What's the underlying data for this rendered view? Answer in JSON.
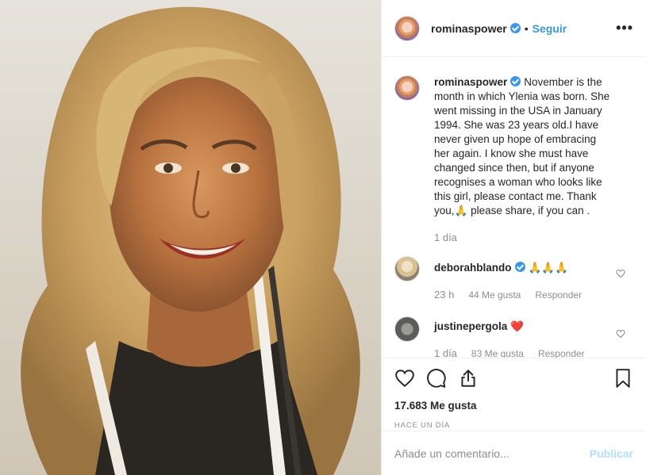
{
  "post": {
    "author": "rominaspower",
    "follow_label": "Seguir",
    "dot": "•",
    "more_label": "•••",
    "caption": {
      "username": "rominaspower",
      "text": "November is the month in which Ylenia was born. She went missing in the USA in January 1994. She was 23 years old.I have never given up hope of embracing her again. I know she must have changed since then, but if anyone recognises a woman who looks like this girl, please contact me. Thank you,🙏 please share, if you can .",
      "time": "1 día"
    },
    "comments": [
      {
        "username": "deborahblando",
        "verified": true,
        "text": "🙏🙏🙏",
        "time": "23 h",
        "likes": "44 Me gusta",
        "reply_label": "Responder"
      },
      {
        "username": "justinepergola",
        "verified": false,
        "text": "❤️",
        "time": "1 día",
        "likes": "83 Me gusta",
        "reply_label": "Responder"
      }
    ],
    "likes_count": "17.683 Me gusta",
    "posted_ago": "HACE UN DÍA",
    "comment_placeholder": "Añade un comentario...",
    "publish_label": "Publicar"
  },
  "icons": {
    "like": "heart-icon",
    "comment": "comment-icon",
    "share": "share-icon",
    "save": "bookmark-icon",
    "verified": "verified-badge-icon"
  },
  "colors": {
    "accent": "#3897f0",
    "publish_disabled": "#b2dffc",
    "muted": "#8e8e8e",
    "heart": "#ed4956"
  }
}
